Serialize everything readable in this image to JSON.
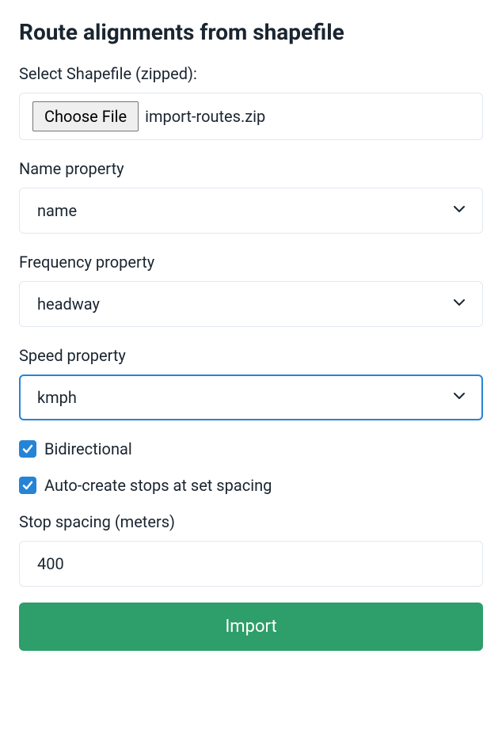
{
  "title": "Route alignments from shapefile",
  "fileField": {
    "label": "Select Shapefile (zipped):",
    "buttonLabel": "Choose File",
    "fileName": "import-routes.zip"
  },
  "nameProperty": {
    "label": "Name property",
    "value": "name"
  },
  "frequencyProperty": {
    "label": "Frequency property",
    "value": "headway"
  },
  "speedProperty": {
    "label": "Speed property",
    "value": "kmph"
  },
  "bidirectional": {
    "label": "Bidirectional",
    "checked": true
  },
  "autoCreateStops": {
    "label": "Auto-create stops at set spacing",
    "checked": true
  },
  "stopSpacing": {
    "label": "Stop spacing (meters)",
    "value": "400"
  },
  "importButton": {
    "label": "Import"
  },
  "colors": {
    "accent": "#2684d6",
    "primary": "#2e9e6a"
  }
}
